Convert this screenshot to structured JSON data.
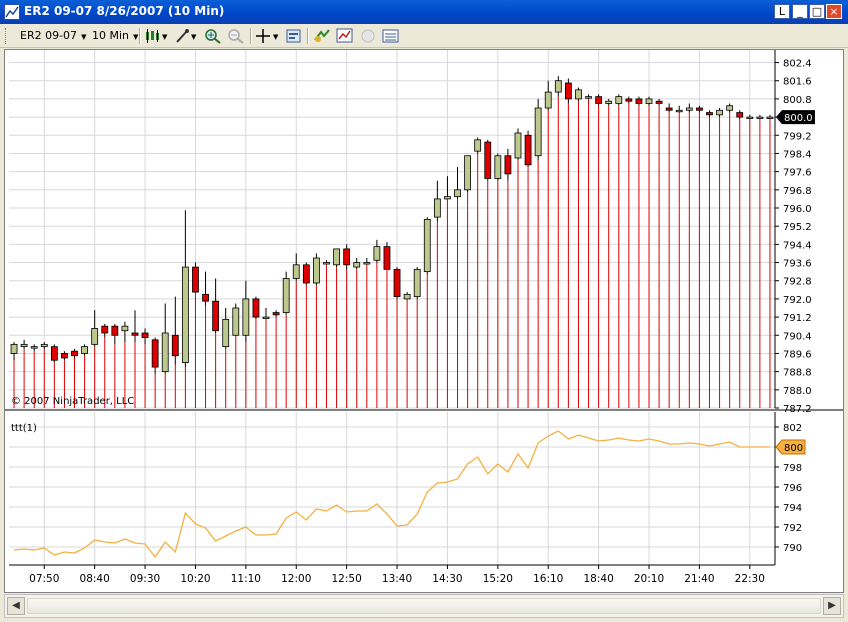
{
  "window": {
    "title": "ER2 09-07  8/26/2007  (10 Min)",
    "controls": [
      "L",
      "_",
      "□",
      "×"
    ]
  },
  "toolbar": {
    "instrument": "ER2 09-07",
    "interval": "10 Min"
  },
  "copyright": "© 2007 NinjaTrader, LLC",
  "colors": {
    "up": "#bcc88c",
    "down": "#dd0000",
    "line": "#f5b041",
    "grid": "#d8d8d8"
  },
  "chart_data": [
    {
      "type": "candlestick",
      "panel": "price",
      "ylim": [
        787.2,
        802.6
      ],
      "yticks": [
        "802.4",
        "801.6",
        "800.8",
        "800.0",
        "799.2",
        "798.4",
        "797.6",
        "796.8",
        "796.0",
        "795.2",
        "794.4",
        "793.6",
        "792.8",
        "792.0",
        "791.2",
        "790.4",
        "789.6",
        "788.8",
        "788.0",
        "787.2"
      ],
      "last_price": "800.0",
      "candles": [
        [
          789.6,
          790.0,
          789.3,
          790.1
        ],
        [
          789.9,
          790.0,
          789.8,
          790.2
        ],
        [
          789.9,
          789.9,
          789.7,
          790.0
        ],
        [
          789.9,
          790.0,
          789.8,
          790.1
        ],
        [
          789.9,
          789.3,
          789.2,
          790.0
        ],
        [
          789.6,
          789.4,
          789.3,
          789.7
        ],
        [
          789.7,
          789.5,
          789.4,
          789.8
        ],
        [
          789.6,
          789.9,
          789.5,
          790.0
        ],
        [
          790.0,
          790.7,
          789.9,
          791.5
        ],
        [
          790.8,
          790.5,
          790.3,
          790.9
        ],
        [
          790.8,
          790.4,
          790.0,
          790.9
        ],
        [
          790.6,
          790.8,
          790.1,
          791.0
        ],
        [
          790.5,
          790.4,
          790.1,
          791.5
        ],
        [
          790.5,
          790.3,
          790.0,
          790.7
        ],
        [
          790.2,
          789.0,
          788.7,
          790.3
        ],
        [
          788.8,
          790.5,
          788.7,
          791.8
        ],
        [
          790.4,
          789.5,
          789.1,
          792.1
        ],
        [
          789.2,
          793.4,
          789.0,
          795.9
        ],
        [
          793.4,
          792.3,
          792.3,
          793.6
        ],
        [
          792.2,
          791.9,
          791.7,
          793.2
        ],
        [
          791.9,
          790.6,
          790.5,
          792.9
        ],
        [
          789.9,
          791.1,
          789.8,
          791.6
        ],
        [
          790.4,
          791.6,
          790.4,
          791.8
        ],
        [
          790.4,
          792.0,
          790.1,
          792.8
        ],
        [
          792.0,
          791.2,
          791.1,
          792.1
        ],
        [
          791.2,
          791.2,
          791.1,
          791.6
        ],
        [
          791.4,
          791.3,
          791.2,
          791.5
        ],
        [
          791.4,
          792.9,
          791.3,
          793.2
        ],
        [
          792.9,
          793.5,
          792.8,
          794.0
        ],
        [
          793.5,
          792.7,
          792.6,
          793.6
        ],
        [
          792.7,
          793.8,
          792.6,
          794.0
        ],
        [
          793.6,
          793.6,
          793.5,
          793.7
        ],
        [
          793.5,
          794.2,
          793.4,
          794.2
        ],
        [
          794.2,
          793.5,
          793.3,
          794.4
        ],
        [
          793.4,
          793.6,
          793.3,
          793.8
        ],
        [
          793.6,
          793.6,
          793.5,
          793.8
        ],
        [
          793.7,
          794.3,
          793.6,
          794.6
        ],
        [
          794.3,
          793.3,
          793.3,
          794.5
        ],
        [
          793.3,
          792.1,
          792.0,
          793.4
        ],
        [
          792.0,
          792.2,
          792.0,
          792.3
        ],
        [
          792.1,
          793.3,
          792.0,
          793.4
        ],
        [
          793.2,
          795.5,
          793.1,
          795.6
        ],
        [
          795.6,
          796.4,
          795.4,
          797.2
        ],
        [
          796.4,
          796.5,
          796.4,
          797.4
        ],
        [
          796.5,
          796.8,
          796.4,
          797.8
        ],
        [
          796.8,
          798.3,
          796.7,
          798.3
        ],
        [
          798.5,
          799.0,
          798.4,
          799.1
        ],
        [
          798.9,
          797.3,
          797.2,
          799.0
        ],
        [
          797.3,
          798.3,
          797.2,
          798.4
        ],
        [
          798.3,
          797.5,
          797.2,
          798.6
        ],
        [
          798.2,
          799.3,
          798.1,
          799.5
        ],
        [
          799.2,
          797.9,
          797.8,
          799.4
        ],
        [
          798.3,
          800.4,
          798.1,
          800.8
        ],
        [
          800.4,
          801.1,
          800.3,
          801.6
        ],
        [
          801.1,
          801.6,
          800.9,
          801.8
        ],
        [
          801.5,
          800.8,
          800.6,
          801.7
        ],
        [
          800.8,
          801.2,
          800.7,
          801.3
        ],
        [
          800.9,
          800.9,
          800.8,
          801.0
        ],
        [
          800.9,
          800.6,
          800.5,
          801.0
        ],
        [
          800.6,
          800.7,
          800.5,
          800.8
        ],
        [
          800.6,
          800.9,
          800.5,
          801.0
        ],
        [
          800.8,
          800.7,
          800.6,
          800.9
        ],
        [
          800.8,
          800.6,
          800.5,
          800.9
        ],
        [
          800.6,
          800.8,
          800.5,
          800.9
        ],
        [
          800.7,
          800.6,
          800.5,
          800.8
        ],
        [
          800.4,
          800.3,
          800.2,
          800.6
        ],
        [
          800.3,
          800.3,
          800.2,
          800.5
        ],
        [
          800.3,
          800.4,
          800.2,
          800.6
        ],
        [
          800.4,
          800.3,
          800.2,
          800.5
        ],
        [
          800.2,
          800.1,
          800.0,
          800.3
        ],
        [
          800.1,
          800.3,
          800.0,
          800.4
        ],
        [
          800.3,
          800.5,
          800.2,
          800.6
        ],
        [
          800.2,
          800.0,
          799.9,
          800.3
        ],
        [
          800.0,
          800.0,
          799.9,
          800.1
        ],
        [
          800.0,
          800.0,
          799.9,
          800.1
        ],
        [
          800.0,
          800.0,
          799.9,
          800.1
        ]
      ],
      "xticks": [
        "07:50",
        "08:40",
        "09:30",
        "10:20",
        "11:10",
        "12:00",
        "12:50",
        "13:40",
        "14:30",
        "15:20",
        "16:10",
        "18:40",
        "20:10",
        "21:40",
        "22:30"
      ],
      "xtick_bars": [
        3,
        8,
        13,
        18,
        23,
        28,
        33,
        38,
        43,
        48,
        53,
        58,
        63,
        68,
        73
      ]
    },
    {
      "type": "line",
      "panel": "indicator",
      "title": "ttt(1)",
      "ylim": [
        788.5,
        802.5
      ],
      "yticks": [
        "802",
        "800",
        "798",
        "796",
        "794",
        "792",
        "790"
      ],
      "last_value": "800",
      "values": [
        789.7,
        789.8,
        789.7,
        789.9,
        789.2,
        789.5,
        789.4,
        789.9,
        790.7,
        790.5,
        790.4,
        790.8,
        790.4,
        790.3,
        789.0,
        790.5,
        789.5,
        793.4,
        792.3,
        791.9,
        790.6,
        791.1,
        791.6,
        792.0,
        791.2,
        791.2,
        791.3,
        792.9,
        793.5,
        792.7,
        793.8,
        793.6,
        794.2,
        793.5,
        793.6,
        793.6,
        794.3,
        793.3,
        792.1,
        792.2,
        793.3,
        795.5,
        796.4,
        796.5,
        796.8,
        798.3,
        799.0,
        797.3,
        798.3,
        797.5,
        799.3,
        797.9,
        800.4,
        801.1,
        801.6,
        800.8,
        801.2,
        800.9,
        800.6,
        800.7,
        800.9,
        800.7,
        800.6,
        800.8,
        800.6,
        800.3,
        800.3,
        800.4,
        800.3,
        800.1,
        800.3,
        800.5,
        800.0,
        800.0,
        800.0,
        800.0
      ]
    }
  ]
}
